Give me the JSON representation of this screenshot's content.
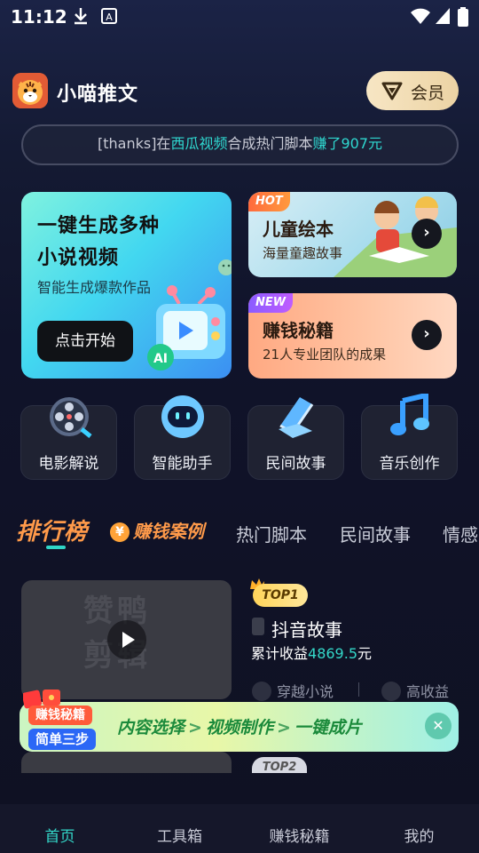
{
  "status_bar": {
    "time": "11:12"
  },
  "header": {
    "app_title": "小喵推文",
    "vip_label": "会员"
  },
  "notice": {
    "prefix": "[thanks]在",
    "platform": "西瓜视频",
    "middle": "合成热门脚本",
    "earned": "赚了907元"
  },
  "hero_card": {
    "line1": "一键生成多种",
    "line2": "小说视频",
    "subtitle": "智能生成爆款作品",
    "button": "点击开始",
    "ai_badge": "AI"
  },
  "side_cards": [
    {
      "tag": "HOT",
      "title": "儿童绘本",
      "subtitle": "海量童趣故事"
    },
    {
      "tag": "NEW",
      "title": "赚钱秘籍",
      "subtitle": "21人专业团队的成果"
    }
  ],
  "shortcuts": [
    {
      "label": "电影解说"
    },
    {
      "label": "智能助手"
    },
    {
      "label": "民间故事"
    },
    {
      "label": "音乐创作"
    }
  ],
  "tabs": {
    "rank": "排行榜",
    "case": "赚钱案例",
    "case_coin": "¥",
    "hot_script": "热门脚本",
    "folk": "民间故事",
    "emotion": "情感"
  },
  "list_item": {
    "rank": "TOP1",
    "thumb_watermark": "赞鸭 剪辑",
    "title": "抖音故事",
    "earn_label": "累计收益",
    "earn_value": "4869.5",
    "earn_unit": "元",
    "tags": [
      "穿越小说",
      "高收益"
    ]
  },
  "list_item_2": {
    "rank": "TOP2"
  },
  "banner": {
    "badge_top": "赚钱秘籍",
    "badge_bottom": "简单三步",
    "steps": [
      "内容选择",
      "视频制作",
      "一键成片"
    ],
    "separator": ">",
    "close": "✕"
  },
  "bottom_nav": {
    "items": [
      "首页",
      "工具箱",
      "赚钱秘籍",
      "我的"
    ],
    "active_index": 0,
    "accent": "#33d6c8"
  }
}
